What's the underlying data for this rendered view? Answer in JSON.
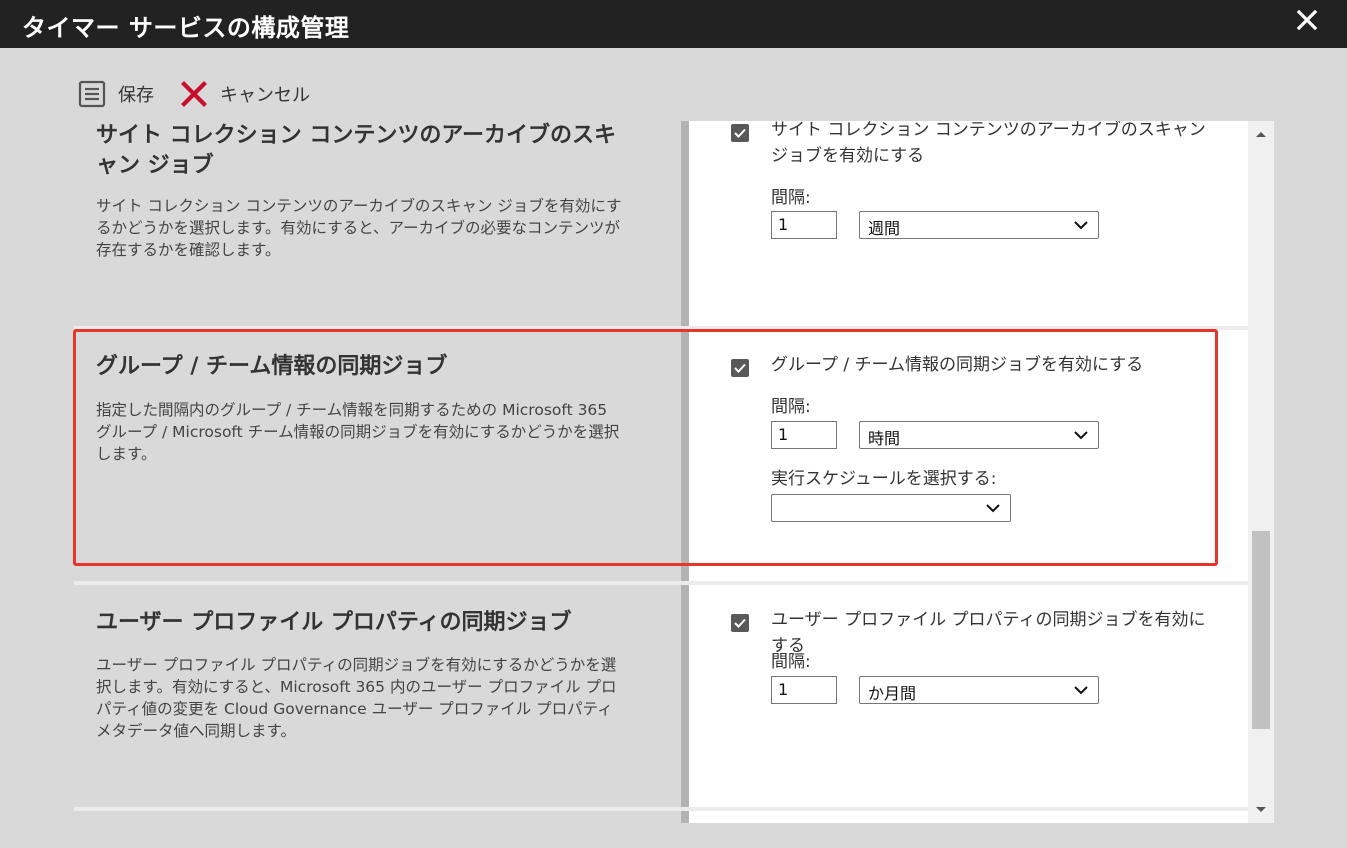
{
  "window": {
    "title": "タイマー サービスの構成管理"
  },
  "toolbar": {
    "save_label": "保存",
    "cancel_label": "キャンセル"
  },
  "sections": [
    {
      "title": "サイト コレクション コンテンツのアーカイブのスキャン ジョブ",
      "description": "サイト コレクション コンテンツのアーカイブのスキャン ジョブを有効にするかどうかを選択します。有効にすると、アーカイブの必要なコンテンツが存在するかを確認します。",
      "checkbox_label": "サイト コレクション コンテンツのアーカイブのスキャン ジョブを有効にする",
      "checked": true,
      "interval_label": "間隔:",
      "interval_value": "1",
      "unit": "週間"
    },
    {
      "title": "グループ / チーム情報の同期ジョブ",
      "description": "指定した間隔内のグループ / チーム情報を同期するための Microsoft 365 グループ / Microsoft チーム情報の同期ジョブを有効にするかどうかを選択します。",
      "checkbox_label": "グループ / チーム情報の同期ジョブを有効にする",
      "checked": true,
      "interval_label": "間隔:",
      "interval_value": "1",
      "unit": "時間",
      "schedule_label": "実行スケジュールを選択する:",
      "schedule_value": "",
      "highlighted": true
    },
    {
      "title": "ユーザー プロファイル プロパティの同期ジョブ",
      "description": "ユーザー プロファイル プロパティの同期ジョブを有効にするかどうかを選択します。有効にすると、Microsoft 365 内のユーザー プロファイル プロパティ値の変更を Cloud Governance ユーザー プロファイル プロパティ メタデータ値へ同期します。",
      "checkbox_label": "ユーザー プロファイル プロパティの同期ジョブを有効にする",
      "checked": true,
      "interval_label": "間隔:",
      "interval_value": "1",
      "unit": "か月間"
    }
  ],
  "icons": {
    "save": "floppy-list-icon",
    "cancel": "red-x-icon",
    "close": "close-icon"
  },
  "colors": {
    "titlebar": "#222222",
    "highlight": "#e8342a",
    "cancel_icon": "#c8102e"
  }
}
